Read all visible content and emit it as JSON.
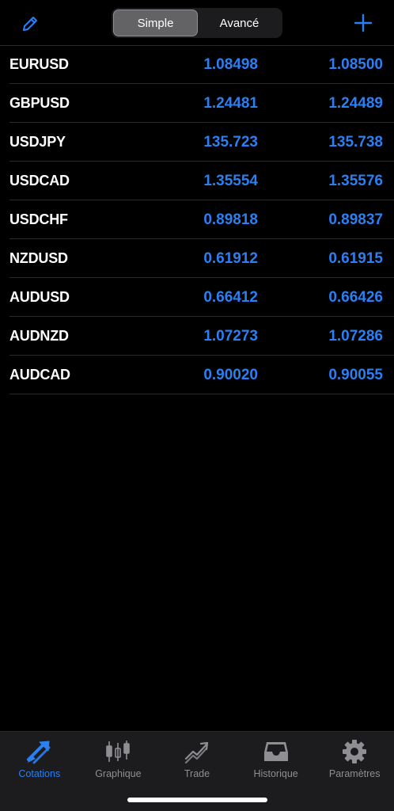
{
  "header": {
    "edit_icon": "pencil-icon",
    "add_icon": "plus-icon",
    "segments": [
      {
        "label": "Simple",
        "active": true
      },
      {
        "label": "Avancé",
        "active": false
      }
    ]
  },
  "quotes": [
    {
      "symbol": "EURUSD",
      "bid": "1.08498",
      "ask": "1.08500"
    },
    {
      "symbol": "GBPUSD",
      "bid": "1.24481",
      "ask": "1.24489"
    },
    {
      "symbol": "USDJPY",
      "bid": "135.723",
      "ask": "135.738"
    },
    {
      "symbol": "USDCAD",
      "bid": "1.35554",
      "ask": "1.35576"
    },
    {
      "symbol": "USDCHF",
      "bid": "0.89818",
      "ask": "0.89837"
    },
    {
      "symbol": "NZDUSD",
      "bid": "0.61912",
      "ask": "0.61915"
    },
    {
      "symbol": "AUDUSD",
      "bid": "0.66412",
      "ask": "0.66426"
    },
    {
      "symbol": "AUDNZD",
      "bid": "1.07273",
      "ask": "1.07286"
    },
    {
      "symbol": "AUDCAD",
      "bid": "0.90020",
      "ask": "0.90055"
    }
  ],
  "tabbar": {
    "tabs": [
      {
        "label": "Cotations",
        "icon": "quotes-arrows-icon",
        "active": true
      },
      {
        "label": "Graphique",
        "icon": "candlestick-icon",
        "active": false
      },
      {
        "label": "Trade",
        "icon": "trade-chart-icon",
        "active": false
      },
      {
        "label": "Historique",
        "icon": "inbox-tray-icon",
        "active": false
      },
      {
        "label": "Paramètres",
        "icon": "gear-icon",
        "active": false
      }
    ]
  },
  "colors": {
    "accent": "#2c7ff0",
    "background": "#000000",
    "tabbar_bg": "#1c1c1e",
    "inactive": "#8e8e93"
  }
}
